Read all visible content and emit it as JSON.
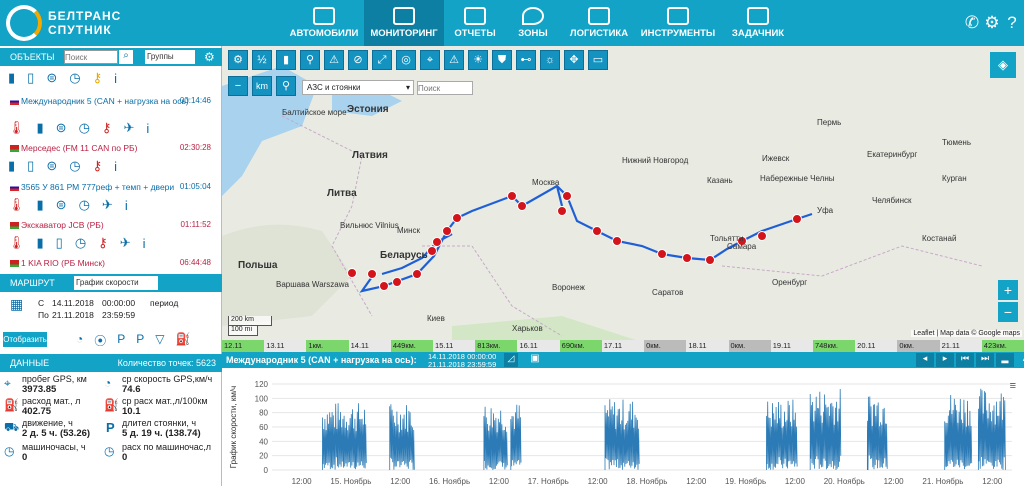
{
  "header": {
    "logo_line1": "БЕЛТРАНС",
    "logo_line2": "СПУТНИК",
    "nav": [
      {
        "label": "АВТОМОБИЛИ"
      },
      {
        "label": "МОНИТОРИНГ",
        "active": true
      },
      {
        "label": "ОТЧЕТЫ"
      },
      {
        "label": "ЗОНЫ"
      },
      {
        "label": "ЛОГИСТИКА"
      },
      {
        "label": "ИНСТРУМЕНТЫ"
      },
      {
        "label": "ЗАДАЧНИК"
      }
    ]
  },
  "objects": {
    "title": "ОБЪЕКТЫ",
    "search_placeholder": "Поиск",
    "group_select": "Группы",
    "items": [
      {
        "name": "Международник 5 (CAN + нагрузка на ось)",
        "time": "00:14:46"
      },
      {
        "name": "Мерседес (FM 11 CAN по РБ)",
        "time": "02:30:28"
      },
      {
        "name": "3565 У 861 РМ 777реф + темп + двери",
        "time": "01:05:04"
      },
      {
        "name": "Экскаватор JCB (РБ)",
        "time": "01:11:52"
      },
      {
        "name": "1 KIA RIO (РБ Минск)",
        "time": "06:44:48"
      }
    ]
  },
  "route": {
    "title": "МАРШРУТ",
    "select": "График скорости",
    "from_label": "С",
    "to_label": "По",
    "from_date": "14.11.2018",
    "from_time": "00:00:00",
    "to_date": "21.11.2018",
    "to_time": "23:59:59",
    "period_label": "период",
    "show_button": "Отобразить"
  },
  "data": {
    "title": "ДАННЫЕ",
    "points_label": "Количество точек: 5623",
    "items": [
      {
        "label": "пробег GPS, км",
        "value": "3973.85"
      },
      {
        "label": "ср скорость GPS,км/ч",
        "value": "74.6"
      },
      {
        "label": "расход мат., л",
        "value": "402.75"
      },
      {
        "label": "ср расх мат.,л/100км",
        "value": "10.1"
      },
      {
        "label": "движение, ч",
        "value": "2 д. 5 ч. (53.26)"
      },
      {
        "label": "длител стоянки, ч",
        "value": "5 д. 19 ч. (138.74)"
      },
      {
        "label": "машиночасы, ч",
        "value": "0"
      },
      {
        "label": "расх по машиночас,л",
        "value": "0"
      }
    ]
  },
  "map": {
    "poi_select": "АЗС и стоянки",
    "search_placeholder": "Поиск",
    "km_label": "km",
    "scale_km": "200 km",
    "scale_mi": "100 mi",
    "attribution": "Leaflet | Map data © Google maps",
    "cities": [
      {
        "n": "Эстония",
        "cls": "country",
        "x": 125,
        "y": 58
      },
      {
        "n": "Латвия",
        "cls": "country",
        "x": 130,
        "y": 104
      },
      {
        "n": "Литва",
        "cls": "country",
        "x": 105,
        "y": 142
      },
      {
        "n": "Польша",
        "cls": "country",
        "x": 16,
        "y": 214
      },
      {
        "n": "Беларусь",
        "cls": "country",
        "x": 158,
        "y": 204
      },
      {
        "n": "Москва",
        "cls": "city",
        "x": 310,
        "y": 132
      },
      {
        "n": "Нижний Новгород",
        "cls": "city",
        "x": 400,
        "y": 110
      },
      {
        "n": "Казань",
        "cls": "city",
        "x": 485,
        "y": 130
      },
      {
        "n": "Пермь",
        "cls": "city",
        "x": 595,
        "y": 72
      },
      {
        "n": "Екатеринбург",
        "cls": "city",
        "x": 645,
        "y": 104
      },
      {
        "n": "Набережные Челны",
        "cls": "city",
        "x": 538,
        "y": 128
      },
      {
        "n": "Уфа",
        "cls": "city",
        "x": 595,
        "y": 160
      },
      {
        "n": "Челябинск",
        "cls": "city",
        "x": 650,
        "y": 150
      },
      {
        "n": "Самара",
        "cls": "city",
        "x": 505,
        "y": 196
      },
      {
        "n": "Саратов",
        "cls": "city",
        "x": 430,
        "y": 242
      },
      {
        "n": "Воронеж",
        "cls": "city",
        "x": 330,
        "y": 237
      },
      {
        "n": "Минск",
        "cls": "city",
        "x": 175,
        "y": 180
      },
      {
        "n": "Вильнюс Vilnius",
        "cls": "city",
        "x": 118,
        "y": 175
      },
      {
        "n": "Киев",
        "cls": "city",
        "x": 205,
        "y": 268
      },
      {
        "n": "Харьков",
        "cls": "city",
        "x": 290,
        "y": 278
      },
      {
        "n": "Варшава Warszawa",
        "cls": "city",
        "x": 54,
        "y": 234
      },
      {
        "n": "Оренбург",
        "cls": "city",
        "x": 550,
        "y": 232
      },
      {
        "n": "Балтийское море",
        "cls": "city",
        "x": 60,
        "y": 62
      },
      {
        "n": "Ижевск",
        "cls": "city",
        "x": 540,
        "y": 108
      },
      {
        "n": "Тольятти",
        "cls": "city",
        "x": 488,
        "y": 188
      },
      {
        "n": "Тюмень",
        "cls": "city",
        "x": 720,
        "y": 92
      },
      {
        "n": "Курган",
        "cls": "city",
        "x": 720,
        "y": 128
      },
      {
        "n": "Костанай",
        "cls": "city",
        "x": 700,
        "y": 188
      }
    ]
  },
  "timeline": [
    {
      "d": "12.11",
      "v": "674км."
    },
    {
      "d": "13.11",
      "v": ""
    },
    {
      "d": "",
      "v": "1км."
    },
    {
      "d": "14.11",
      "v": ""
    },
    {
      "d": "",
      "v": "449км."
    },
    {
      "d": "15.11",
      "v": ""
    },
    {
      "d": "",
      "v": "813км."
    },
    {
      "d": "16.11",
      "v": ""
    },
    {
      "d": "",
      "v": "690км."
    },
    {
      "d": "17.11",
      "v": ""
    },
    {
      "d": "",
      "v": "0км."
    },
    {
      "d": "18.11",
      "v": ""
    },
    {
      "d": "",
      "v": "0км."
    },
    {
      "d": "19.11",
      "v": ""
    },
    {
      "d": "",
      "v": "748км."
    },
    {
      "d": "20.11",
      "v": ""
    },
    {
      "d": "",
      "v": "0км."
    },
    {
      "d": "21.11",
      "v": ""
    },
    {
      "d": "",
      "v": "423км."
    }
  ],
  "chart_header": {
    "title": "Международник 5 (CAN + нагрузка на ось):",
    "from": "14.11.2018 00:00:00",
    "to": "21.11.2018 23:59:59"
  },
  "chart_data": {
    "type": "line",
    "ylabel": "График скорости, км/ч",
    "ylim": [
      0,
      120
    ],
    "yticks": [
      0,
      20,
      40,
      60,
      80,
      100,
      120
    ],
    "xticks": [
      "12:00",
      "15. Ноябрь",
      "12:00",
      "16. Ноябрь",
      "12:00",
      "17. Ноябрь",
      "12:00",
      "18. Ноябрь",
      "12:00",
      "19. Ноябрь",
      "12:00",
      "20. Ноябрь",
      "12:00",
      "21. Ноябрь",
      "12:00"
    ],
    "segments": [
      [
        0.135,
        0.2,
        95
      ],
      [
        0.235,
        0.272,
        95
      ],
      [
        0.375,
        0.41,
        95
      ],
      [
        0.415,
        0.43,
        95
      ],
      [
        0.555,
        0.605,
        100
      ],
      [
        0.795,
        0.84,
        100
      ],
      [
        0.86,
        0.905,
        115
      ],
      [
        0.945,
        0.975,
        110
      ],
      [
        1.06,
        1.1,
        110
      ],
      [
        1.11,
        1.15,
        115
      ]
    ]
  }
}
